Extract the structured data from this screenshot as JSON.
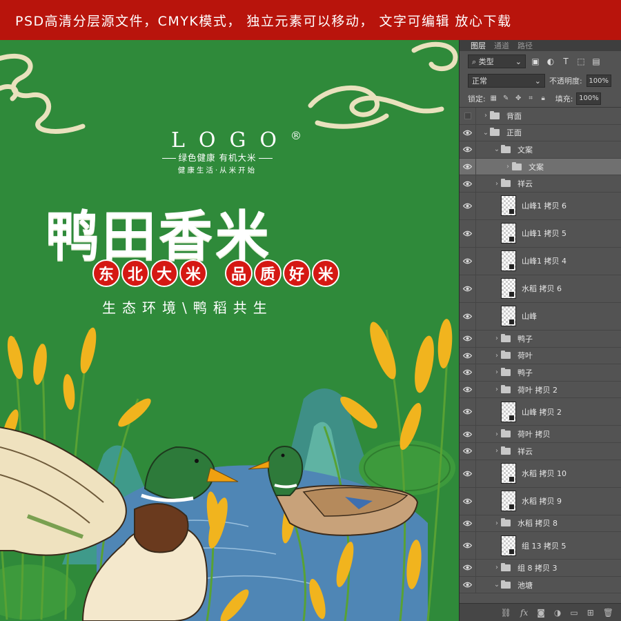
{
  "banner": {
    "text": "PSD高清分层源文件，CMYK模式，  独立元素可以移动，  文字可编辑 放心下载"
  },
  "art": {
    "logo": "LOGO",
    "logo_mark": "®",
    "tagline1": "绿色健康  有机大米",
    "tagline2": "健康生活·从米开始",
    "title": "鸭田香米",
    "badges_left": [
      "东",
      "北",
      "大",
      "米"
    ],
    "badges_right": [
      "品",
      "质",
      "好",
      "米"
    ],
    "subtitle": "生态环境\\鸭稻共生"
  },
  "panel": {
    "tabs": [
      "图层",
      "通道",
      "路径"
    ],
    "filter_kind": "类型",
    "blend_mode": "正常",
    "opacity_label": "不透明度:",
    "opacity_value": "100%",
    "lock_label": "锁定:",
    "fill_label": "填充:",
    "fill_value": "100%",
    "layers": [
      {
        "name": "背面",
        "type": "folder",
        "indent": 0,
        "visible": false,
        "expanded": false
      },
      {
        "name": "正面",
        "type": "folder",
        "indent": 0,
        "visible": true,
        "expanded": true
      },
      {
        "name": "文案",
        "type": "folder",
        "indent": 1,
        "visible": true,
        "expanded": true
      },
      {
        "name": "文案",
        "type": "folder",
        "indent": 2,
        "visible": true,
        "expanded": false,
        "selected": true
      },
      {
        "name": "祥云",
        "type": "folder",
        "indent": 1,
        "visible": true,
        "expanded": false
      },
      {
        "name": "山峰1 拷贝 6",
        "type": "image",
        "indent": 1,
        "visible": true
      },
      {
        "name": "山峰1 拷贝 5",
        "type": "image",
        "indent": 1,
        "visible": true
      },
      {
        "name": "山峰1 拷贝 4",
        "type": "image",
        "indent": 1,
        "visible": true
      },
      {
        "name": "水稻 拷贝 6",
        "type": "image",
        "indent": 1,
        "visible": true
      },
      {
        "name": "山峰",
        "type": "image",
        "indent": 1,
        "visible": true
      },
      {
        "name": "鸭子",
        "type": "folder",
        "indent": 1,
        "visible": true,
        "expanded": false
      },
      {
        "name": "荷叶",
        "type": "folder",
        "indent": 1,
        "visible": true,
        "expanded": false
      },
      {
        "name": "鸭子",
        "type": "folder",
        "indent": 1,
        "visible": true,
        "expanded": false
      },
      {
        "name": "荷叶 拷贝 2",
        "type": "folder",
        "indent": 1,
        "visible": true,
        "expanded": false
      },
      {
        "name": "山峰 拷贝 2",
        "type": "image",
        "indent": 1,
        "visible": true
      },
      {
        "name": "荷叶 拷贝",
        "type": "folder",
        "indent": 1,
        "visible": true,
        "expanded": false
      },
      {
        "name": "祥云",
        "type": "folder",
        "indent": 1,
        "visible": true,
        "expanded": false
      },
      {
        "name": "水稻 拷贝 10",
        "type": "image",
        "indent": 1,
        "visible": true
      },
      {
        "name": "水稻 拷贝 9",
        "type": "image",
        "indent": 1,
        "visible": true
      },
      {
        "name": "水稻 拷贝 8",
        "type": "folder",
        "indent": 1,
        "visible": true,
        "expanded": false
      },
      {
        "name": "组 13 拷贝 5",
        "type": "image",
        "indent": 1,
        "visible": true
      },
      {
        "name": "组 8 拷贝 3",
        "type": "folder",
        "indent": 1,
        "visible": true,
        "expanded": false
      },
      {
        "name": "池塘",
        "type": "folder",
        "indent": 1,
        "visible": true,
        "expanded": true
      }
    ],
    "footer_icons": [
      "link-icon",
      "fx-icon",
      "mask-icon",
      "adjustment-icon",
      "group-icon",
      "new-layer-icon",
      "trash-icon"
    ]
  },
  "colors": {
    "banner": "#b8140c",
    "background": "#2f8a3a",
    "badge": "#d51813",
    "panel": "#535353"
  }
}
